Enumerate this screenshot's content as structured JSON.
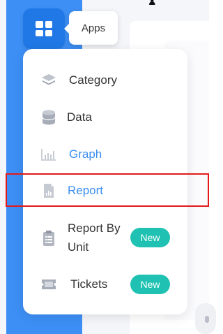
{
  "header": {
    "apps_tooltip": "Apps"
  },
  "menu": {
    "items": [
      {
        "label": "Category",
        "icon": "layers-icon"
      },
      {
        "label": "Data",
        "icon": "database-icon"
      },
      {
        "label": "Graph",
        "icon": "bar-chart-icon"
      },
      {
        "label": "Report",
        "icon": "report-icon"
      },
      {
        "label_line1": "Report By",
        "label_line2": "Unit",
        "icon": "clipboard-icon",
        "badge": "New"
      },
      {
        "label": "Tickets",
        "icon": "ticket-icon",
        "badge": "New"
      }
    ]
  },
  "colors": {
    "sidebar_blue": "#3d8ff5",
    "apps_tile": "#1f78e5",
    "accent_text": "#3b8ef0",
    "badge": "#1fc2b2",
    "highlight": "#e31a1a"
  }
}
